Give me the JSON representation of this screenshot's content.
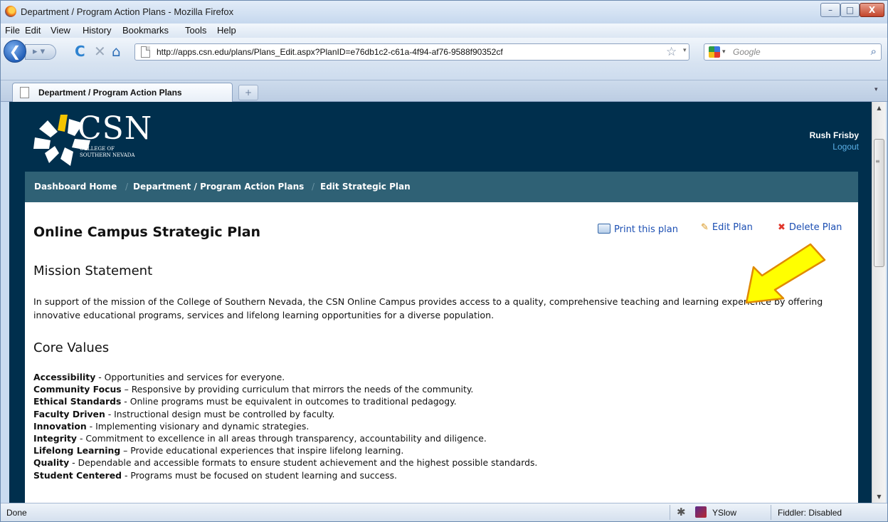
{
  "window": {
    "title": "Department / Program Action Plans - Mozilla Firefox",
    "minimize_glyph": "–",
    "maximize_glyph": "□",
    "close_glyph": "X"
  },
  "menu": [
    "File",
    "Edit",
    "View",
    "History",
    "Bookmarks",
    "Tools",
    "Help"
  ],
  "nav": {
    "back_glyph": "❮",
    "forward_glyph": "▸ ▾",
    "reload_glyph": "C",
    "stop_glyph": "✕",
    "home_glyph": "⌂",
    "url": "http://apps.csn.edu/plans/Plans_Edit.aspx?PlanID=e76db1c2-c61a-4f94-af76-9588f90352cf",
    "star_glyph": "☆",
    "dropdown_glyph": "▾",
    "search_placeholder": "Google",
    "search_go_glyph": "⌕"
  },
  "tabs": {
    "active_label": "Department / Program Action Plans",
    "new_tab_glyph": "+",
    "list_glyph": "▾"
  },
  "site": {
    "logo_text": "CSN",
    "logo_sub_line1": "College of",
    "logo_sub_line2": "Southern Nevada",
    "user_name": "Rush Frisby",
    "logout_label": "Logout",
    "breadcrumbs": [
      "Dashboard Home",
      "Department / Program Action Plans",
      "Edit Strategic Plan"
    ],
    "breadcrumb_sep": "/"
  },
  "plan": {
    "title": "Online Campus Strategic Plan",
    "actions": {
      "print": "Print this plan",
      "edit": "Edit Plan",
      "delete": "Delete Plan",
      "pencil_glyph": "✎",
      "delete_glyph": "✖"
    },
    "mission_heading": "Mission Statement",
    "mission_text": "In support of the mission of the College of Southern Nevada, the CSN Online Campus provides access to a quality, comprehensive teaching and learning experience by offering innovative educational programs, services and lifelong learning opportunities for a diverse population.",
    "values_heading": "Core Values",
    "values": [
      {
        "name": "Accessibility",
        "desc": " - Opportunities and services for everyone."
      },
      {
        "name": "Community Focus",
        "desc": " – Responsive by providing curriculum that mirrors the needs of the community."
      },
      {
        "name": "Ethical Standards",
        "desc": " - Online programs must be equivalent in outcomes to traditional pedagogy."
      },
      {
        "name": "Faculty Driven",
        "desc": " - Instructional design must be controlled by faculty."
      },
      {
        "name": "Innovation",
        "desc": " - Implementing visionary and dynamic strategies."
      },
      {
        "name": "Integrity",
        "desc": " - Commitment to excellence in all areas through transparency, accountability and diligence."
      },
      {
        "name": "Lifelong Learning",
        "desc": " – Provide educational experiences that inspire lifelong learning."
      },
      {
        "name": "Quality",
        "desc": " - Dependable and accessible formats to ensure student achievement and the highest possible standards."
      },
      {
        "name": "Student Centered",
        "desc": " - Programs must be focused on student learning and success."
      }
    ]
  },
  "status": {
    "text": "Done",
    "firebug_glyph": "✱",
    "yslow_label": "YSlow",
    "fiddler_label": "Fiddler: Disabled"
  },
  "scrollbar": {
    "up_glyph": "▲",
    "down_glyph": "▼",
    "grip_glyph": "≡"
  },
  "colors": {
    "page_bg": "#002f4d",
    "crumb_bar": "#2f6175",
    "link": "#1c4fb3",
    "arrow_fill": "#ffff00",
    "logo_yellow": "#f5c400"
  }
}
